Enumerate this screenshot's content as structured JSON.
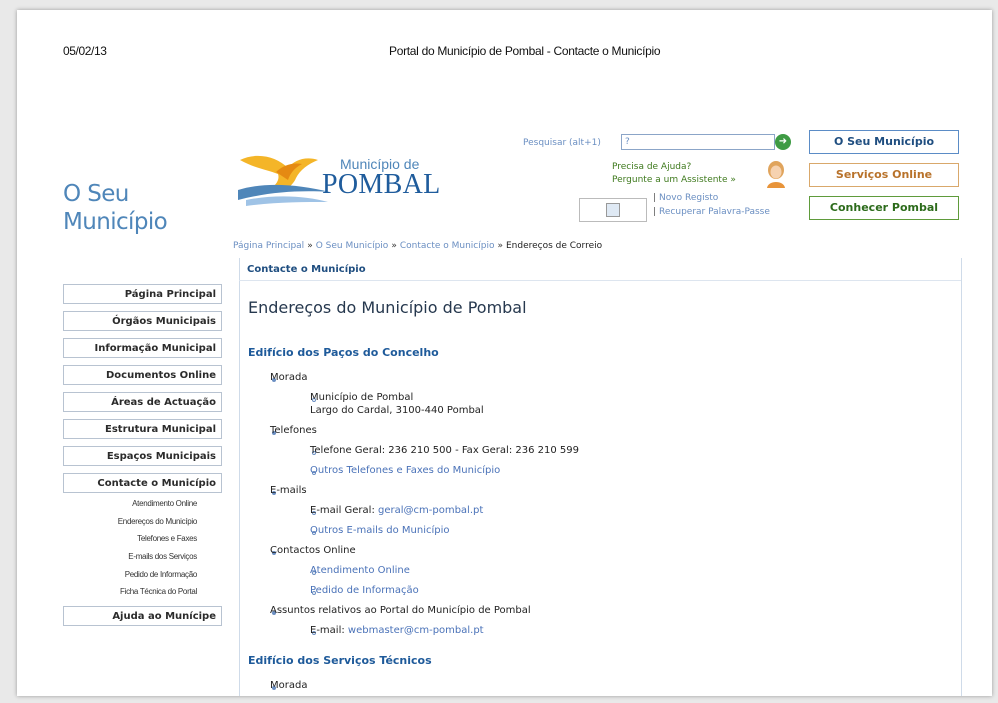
{
  "print": {
    "date": "05/02/13",
    "title": "Portal do Município de Pombal - Contacte o Município"
  },
  "brand": {
    "line1": "O Seu",
    "line2": "Município"
  },
  "logo": {
    "sub": "Município de",
    "main": "POMBAL"
  },
  "search": {
    "label": "Pesquisar (alt+1)",
    "value": "?"
  },
  "help": {
    "question": "Precisa de Ajuda?",
    "action": "Pergunte a um Assistente »"
  },
  "account": {
    "register": "Novo Registo",
    "recover": "Recuperar Palavra-Passe"
  },
  "top_tabs": [
    {
      "label": "O Seu Município",
      "color": "#1f4e80",
      "border": "#5b8cc6"
    },
    {
      "label": "Serviços Online",
      "color": "#b8722a",
      "border": "#d9a86b"
    },
    {
      "label": "Conhecer Pombal",
      "color": "#2c6b1b",
      "border": "#5f9b3b"
    }
  ],
  "breadcrumb": {
    "items": [
      "Página Principal",
      "O Seu Município",
      "Contacte o Município"
    ],
    "current": "Endereços de Correio",
    "separator": "»"
  },
  "content": {
    "header": "Contacte o Município",
    "title": "Endereços do Município de Pombal",
    "section1": "Edifício dos Paços do Concelho",
    "section2": "Edifício dos Serviços Técnicos",
    "morada": "Morada",
    "morada_name": "Município de Pombal",
    "morada_address": "Largo do Cardal, 3100-440 Pombal",
    "telefones": "Telefones",
    "telefone_geral": "Telefone Geral: 236 210 500 - Fax Geral: 236 210 599",
    "outros_telefones": "Outros Telefones e Faxes do Município",
    "emails": "E-mails",
    "email_label": "E-mail Geral: ",
    "email_value": "geral@cm-pombal.pt",
    "outros_emails": "Outros E-mails do Município",
    "contactos_online": "Contactos Online",
    "atendimento_online": "Atendimento Online",
    "pedido_informacao": "Pedido de Informação",
    "assuntos": "Assuntos relativos ao Portal do Município de Pombal",
    "webmaster_label": "E-mail: ",
    "webmaster_value": "webmaster@cm-pombal.pt",
    "morada2": "Morada"
  },
  "nav": [
    "Página Principal",
    "Órgãos Municipais",
    "Informação Municipal",
    "Documentos Online",
    "Áreas de Actuação",
    "Estrutura Municipal",
    "Espaços Municipais",
    "Contacte o Município"
  ],
  "subnav": [
    "Atendimento Online",
    "Endereços do Município",
    "Telefones e Faxes",
    "E-mails dos Serviços",
    "Pedido de Informação",
    "Ficha Técnica do Portal"
  ],
  "nav_help": "Ajuda ao Munícipe",
  "icons": {
    "search_go": "arrow-right-circle-icon",
    "assistant": "assistant-avatar-icon",
    "logo": "bird-logo-icon",
    "broken_image": "broken-image-icon"
  }
}
